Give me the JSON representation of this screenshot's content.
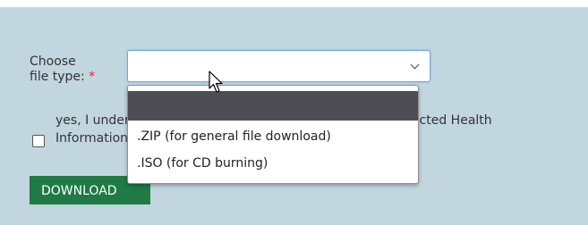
{
  "form": {
    "file_type_label_line1": "Choose",
    "file_type_label_line2": "file type:",
    "required_marker": "*",
    "selected_value": "",
    "agree_line1": "yes, I understand that this file may contain Personal Protected Health",
    "agree_line2": "Information",
    "agree_checked": false,
    "download_label": "DOWNLOAD"
  },
  "dropdown": {
    "options": [
      {
        "label": ""
      },
      {
        "label": ".ZIP (for general file download)"
      },
      {
        "label": ".ISO (for CD burning)"
      }
    ]
  },
  "colors": {
    "panel_bg": "#c2d6e0",
    "button_bg": "#1f7a45",
    "highlight_bg": "#4d4d53",
    "required": "#e8202a"
  },
  "icons": {
    "select_arrow": "chevron-down-icon",
    "cursor": "mouse-pointer-icon"
  }
}
